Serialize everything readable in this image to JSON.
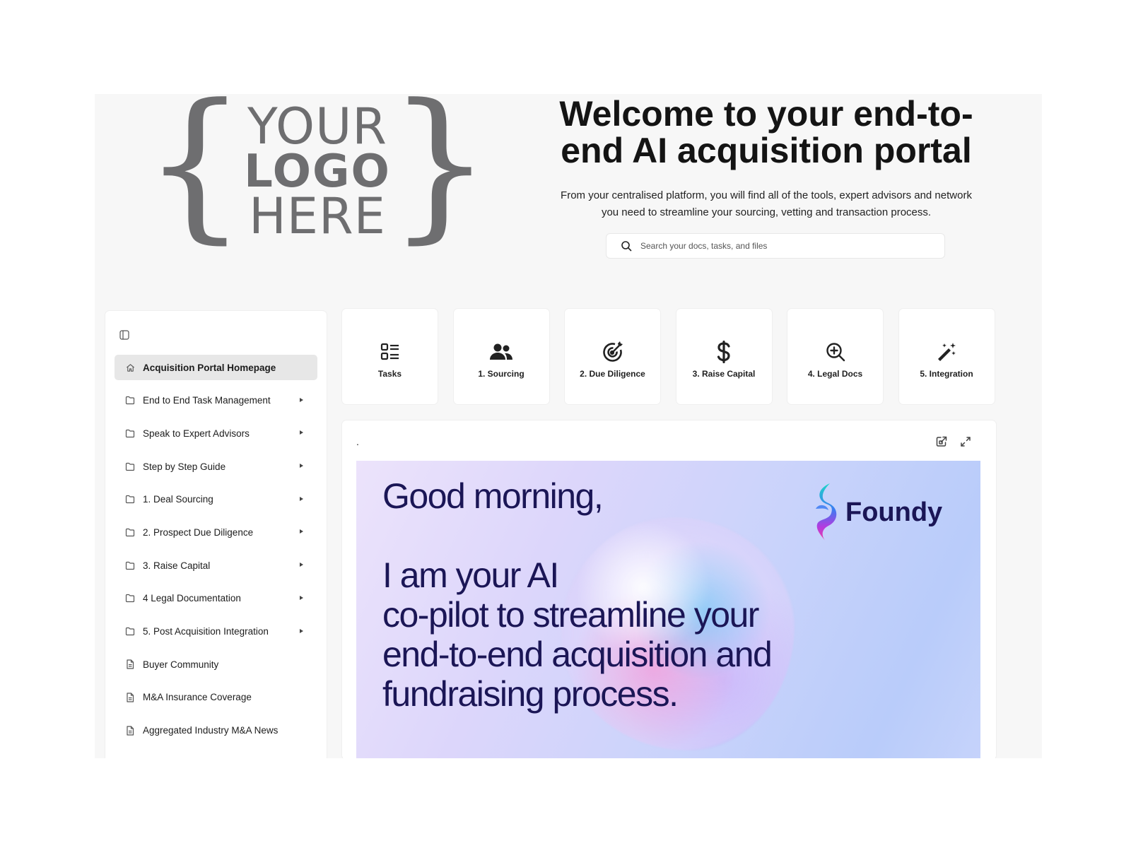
{
  "logo": {
    "line1": "YOUR",
    "line2": "LOGO",
    "line3": "HERE"
  },
  "hero": {
    "title": "Welcome to your end-to-end AI acquisition portal",
    "subtitle": "From your centralised platform, you will find all of the tools, expert advisors and network you need to streamline your sourcing, vetting and transaction process."
  },
  "search": {
    "placeholder": "Search your docs, tasks, and files",
    "icon": "search-icon"
  },
  "sidebar": {
    "toggle_icon": "sidebar-toggle-icon",
    "items": [
      {
        "label": "Acquisition Portal Homepage",
        "icon": "home-icon",
        "active": true,
        "expandable": false
      },
      {
        "label": "End to End Task Management",
        "icon": "folder-icon",
        "active": false,
        "expandable": true
      },
      {
        "label": "Speak to Expert Advisors",
        "icon": "folder-icon",
        "active": false,
        "expandable": true
      },
      {
        "label": "Step by Step Guide",
        "icon": "folder-icon",
        "active": false,
        "expandable": true
      },
      {
        "label": "1. Deal Sourcing",
        "icon": "folder-icon",
        "active": false,
        "expandable": true
      },
      {
        "label": "2. Prospect Due Diligence",
        "icon": "folder-icon",
        "active": false,
        "expandable": true
      },
      {
        "label": "3. Raise Capital",
        "icon": "folder-icon",
        "active": false,
        "expandable": true
      },
      {
        "label": "4 Legal Documentation",
        "icon": "folder-icon",
        "active": false,
        "expandable": true
      },
      {
        "label": "5. Post Acquisition Integration",
        "icon": "folder-icon",
        "active": false,
        "expandable": true
      },
      {
        "label": "Buyer Community",
        "icon": "document-icon",
        "active": false,
        "expandable": false
      },
      {
        "label": "M&A Insurance Coverage",
        "icon": "document-icon",
        "active": false,
        "expandable": false
      },
      {
        "label": "Aggregated Industry M&A News",
        "icon": "document-icon",
        "active": false,
        "expandable": false
      }
    ]
  },
  "tiles": [
    {
      "label": "Tasks",
      "icon": "task-list-icon"
    },
    {
      "label": "1. Sourcing",
      "icon": "users-icon"
    },
    {
      "label": "2. Due Diligence",
      "icon": "target-icon"
    },
    {
      "label": "3. Raise Capital",
      "icon": "dollar-icon"
    },
    {
      "label": "4. Legal Docs",
      "icon": "zoom-in-icon"
    },
    {
      "label": "5. Integration",
      "icon": "magic-wand-icon"
    }
  ],
  "panel": {
    "title": ".",
    "open_external_icon": "open-external-icon",
    "expand_icon": "expand-icon",
    "banner": {
      "greeting": "Good morning,\n\nI am your AI\nco-pilot to streamline your\nend-to-end acquisition and\nfundraising process.",
      "brand_name": "Foundy"
    }
  },
  "colors": {
    "page_bg": "#f7f7f7",
    "card_bg": "#ffffff",
    "active_item_bg": "#e7e7e7",
    "banner_text": "#1b1656",
    "logo_gray": "#6e6e70"
  }
}
